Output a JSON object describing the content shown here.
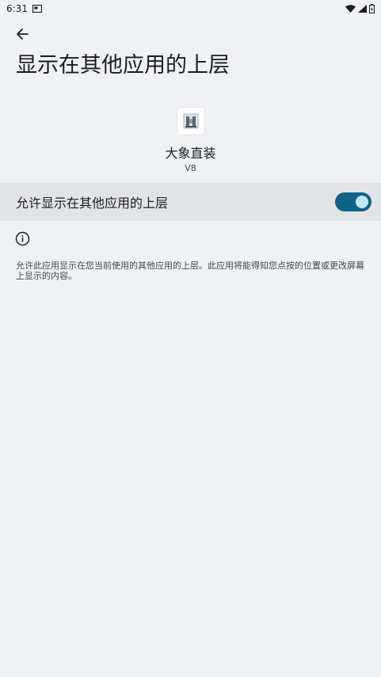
{
  "status_bar": {
    "time": "6:31"
  },
  "header": {
    "title": "显示在其他应用的上层"
  },
  "app": {
    "name": "大象直装",
    "version": "V8"
  },
  "permission": {
    "label": "允许显示在其他应用的上层",
    "enabled": true
  },
  "info": {
    "text": "允许此应用显示在您当前使用的其他应用的上层。此应用将能得知您点按的位置或更改屏幕上显示的内容。"
  },
  "colors": {
    "background": "#eff1f4",
    "row_background": "#e2e4e8",
    "switch_track": "#0f6385",
    "switch_thumb": "#c3e7ff"
  }
}
